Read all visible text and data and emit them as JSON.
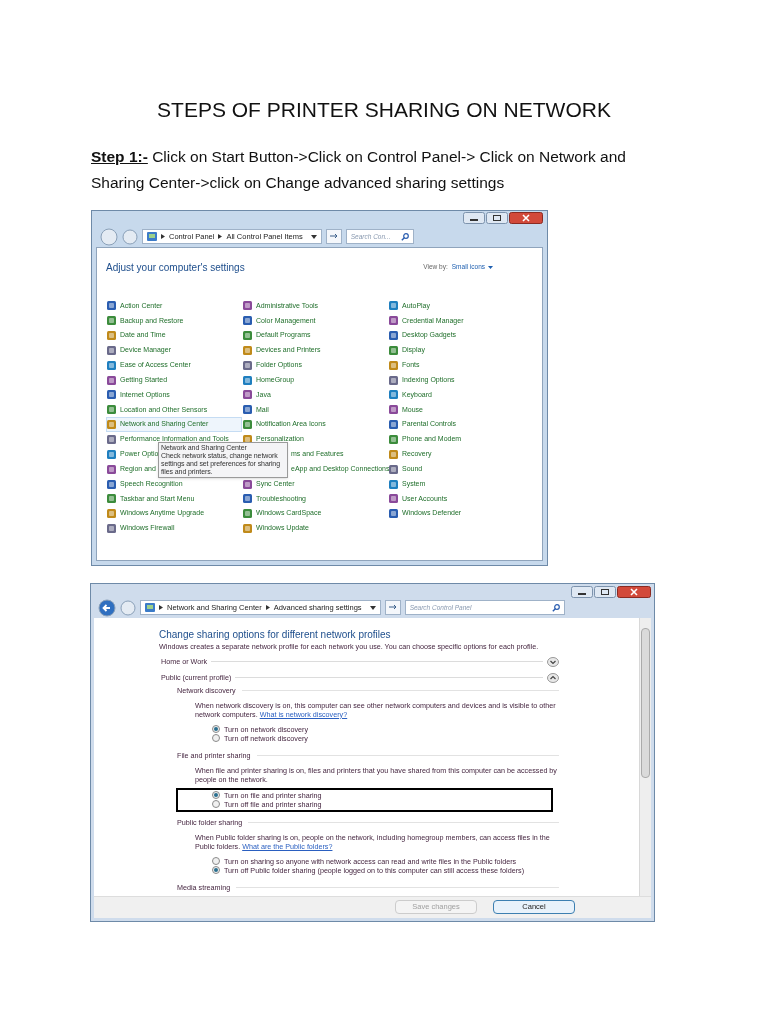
{
  "document": {
    "title": "STEPS OF PRINTER SHARING ON NETWORK",
    "step": {
      "label": "Step 1:-",
      "text": " Click on Start Button->Click on Control Panel-> Click on Network and Sharing Center->click on Change advanced sharing settings"
    }
  },
  "control_panel_window": {
    "breadcrumbs": [
      "Control Panel",
      "All Control Panel Items"
    ],
    "search": {
      "placeholder": "Search Con..."
    },
    "heading": "Adjust your computer's settings",
    "view_by": {
      "label": "View by:",
      "value": "Small icons"
    },
    "columns": [
      [
        {
          "label": "Action Center",
          "kind": "full",
          "selected": false
        },
        {
          "label": "Backup and Restore",
          "kind": "full",
          "selected": false
        },
        {
          "label": "Date and Time",
          "kind": "full",
          "selected": false
        },
        {
          "label": "Device Manager",
          "kind": "full",
          "selected": false
        },
        {
          "label": "Ease of Access Center",
          "kind": "full",
          "selected": false
        },
        {
          "label": "Getting Started",
          "kind": "full",
          "selected": false
        },
        {
          "label": "Internet Options",
          "kind": "full",
          "selected": false
        },
        {
          "label": "Location and Other Sensors",
          "kind": "full",
          "selected": false
        },
        {
          "label": "Network and Sharing Center",
          "kind": "full",
          "selected": true
        },
        {
          "label": "Performance Information and Tools",
          "kind": "full",
          "selected": false
        },
        {
          "label": "Power Optio",
          "kind": "full",
          "selected": false
        },
        {
          "label": "Region and",
          "kind": "full",
          "selected": false
        },
        {
          "label": "Speech Recognition",
          "kind": "full",
          "selected": false
        },
        {
          "label": "Taskbar and Start Menu",
          "kind": "full",
          "selected": false
        },
        {
          "label": "Windows Anytime Upgrade",
          "kind": "full",
          "selected": false
        },
        {
          "label": "Windows Firewall",
          "kind": "full",
          "selected": false
        }
      ],
      [
        {
          "label": "Administrative Tools",
          "kind": "full",
          "selected": false
        },
        {
          "label": "Color Management",
          "kind": "full",
          "selected": false
        },
        {
          "label": "Default Programs",
          "kind": "full",
          "selected": false
        },
        {
          "label": "Devices and Printers",
          "kind": "full",
          "selected": false
        },
        {
          "label": "Folder Options",
          "kind": "full",
          "selected": false
        },
        {
          "label": "HomeGroup",
          "kind": "full",
          "selected": false
        },
        {
          "label": "Java",
          "kind": "full",
          "selected": false
        },
        {
          "label": "Mail",
          "kind": "full",
          "selected": false
        },
        {
          "label": "Notification Area Icons",
          "kind": "full",
          "selected": false
        },
        {
          "label": "Personalization",
          "kind": "full",
          "selected": false
        },
        {
          "label": "ms and Features",
          "kind": "covered",
          "selected": false
        },
        {
          "label": "eApp and Desktop Connections",
          "kind": "covered",
          "selected": false
        },
        {
          "label": "Sync Center",
          "kind": "full",
          "selected": false
        },
        {
          "label": "Troubleshooting",
          "kind": "full",
          "selected": false
        },
        {
          "label": "Windows CardSpace",
          "kind": "full",
          "selected": false
        },
        {
          "label": "Windows Update",
          "kind": "full",
          "selected": false
        }
      ],
      [
        {
          "label": "AutoPlay",
          "kind": "full",
          "selected": false
        },
        {
          "label": "Credential Manager",
          "kind": "full",
          "selected": false
        },
        {
          "label": "Desktop Gadgets",
          "kind": "full",
          "selected": false
        },
        {
          "label": "Display",
          "kind": "full",
          "selected": false
        },
        {
          "label": "Fonts",
          "kind": "full",
          "selected": false
        },
        {
          "label": "Indexing Options",
          "kind": "full",
          "selected": false
        },
        {
          "label": "Keyboard",
          "kind": "full",
          "selected": false
        },
        {
          "label": "Mouse",
          "kind": "full",
          "selected": false
        },
        {
          "label": "Parental Controls",
          "kind": "full",
          "selected": false
        },
        {
          "label": "Phone and Modem",
          "kind": "full",
          "selected": false
        },
        {
          "label": "Recovery",
          "kind": "full",
          "selected": false
        },
        {
          "label": "Sound",
          "kind": "full",
          "selected": false
        },
        {
          "label": "System",
          "kind": "full",
          "selected": false
        },
        {
          "label": "User Accounts",
          "kind": "full",
          "selected": false
        },
        {
          "label": "Windows Defender",
          "kind": "full",
          "selected": false
        }
      ]
    ],
    "tooltip": {
      "title": "Network and Sharing Center",
      "text": "Check network status, change network settings and set preferences for sharing files and printers."
    }
  },
  "sharing_window": {
    "breadcrumbs": [
      "Network and Sharing Center",
      "Advanced sharing settings"
    ],
    "search": {
      "placeholder": "Search Control Panel"
    },
    "heading": "Change sharing options for different network profiles",
    "intro": "Windows creates a separate network profile for each network you use. You can choose specific options for each profile.",
    "profiles": [
      {
        "label": "Home or Work",
        "expanded": false
      },
      {
        "label": "Public (current profile)",
        "expanded": true,
        "sections": [
          {
            "heading": "Network discovery",
            "description": "When network discovery is on, this computer can see other network computers and devices and is visible to other network computers.",
            "link": "What is network discovery?",
            "highlighted": false,
            "options": [
              {
                "label": "Turn on network discovery",
                "selected": true
              },
              {
                "label": "Turn off network discovery",
                "selected": false
              }
            ]
          },
          {
            "heading": "File and printer sharing",
            "description": "When file and printer sharing is on, files and printers that you have shared from this computer can be accessed by people on the network.",
            "highlighted": true,
            "options": [
              {
                "label": "Turn on file and printer sharing",
                "selected": true
              },
              {
                "label": "Turn off file and printer sharing",
                "selected": false
              }
            ]
          },
          {
            "heading": "Public folder sharing",
            "description": "When Public folder sharing is on, people on the network, including homegroup members, can access files in the Public folders.",
            "link": "What are the Public folders?",
            "highlighted": false,
            "options": [
              {
                "label": "Turn on sharing so anyone with network access can read and write files in the Public folders",
                "selected": false
              },
              {
                "label": "Turn off Public folder sharing (people logged on to this computer can still access these folders)",
                "selected": true
              }
            ]
          },
          {
            "heading": "Media streaming"
          }
        ]
      }
    ],
    "buttons": [
      {
        "label": "Save changes",
        "disabled": true
      },
      {
        "label": "Cancel",
        "disabled": false
      }
    ]
  }
}
